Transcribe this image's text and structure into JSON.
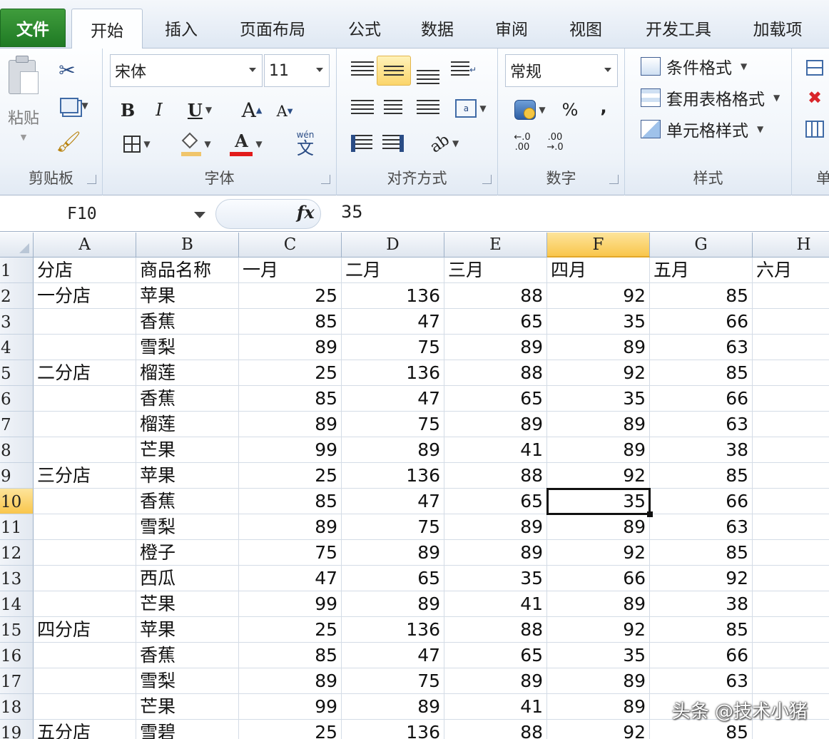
{
  "tabs": {
    "file": "文件",
    "items": [
      "开始",
      "插入",
      "页面布局",
      "公式",
      "数据",
      "审阅",
      "视图",
      "开发工具",
      "加载项"
    ]
  },
  "ribbon": {
    "clipboard": {
      "label": "剪贴板",
      "paste": "粘贴"
    },
    "font": {
      "label": "字体",
      "name": "宋体",
      "size": "11",
      "bold": "B",
      "italic": "I",
      "underline": "U",
      "grow": "A",
      "shrink": "A",
      "wen": "wén",
      "wen_char": "文"
    },
    "alignment": {
      "label": "对齐方式"
    },
    "number": {
      "label": "数字",
      "format": "常规",
      "percent": "%",
      "comma": ",",
      "inc": "←.0 .00",
      "dec": ".00 →.0"
    },
    "styles": {
      "label": "样式",
      "conditional": "条件格式",
      "table": "套用表格格式",
      "cell_styles": "单元格样式"
    },
    "cells": {
      "label": "单"
    }
  },
  "formula_bar": {
    "name_box": "F10",
    "fx": "fx",
    "value": "35"
  },
  "grid": {
    "columns": [
      "A",
      "B",
      "C",
      "D",
      "E",
      "F",
      "G",
      "H"
    ],
    "selected_column": "F",
    "selected_row": "10",
    "rows": [
      {
        "n": "1",
        "a": "分店",
        "b": "商品名称",
        "c": "一月",
        "d": "二月",
        "e": "三月",
        "f": "四月",
        "g": "五月",
        "h": "六月"
      },
      {
        "n": "2",
        "a": "一分店",
        "b": "苹果",
        "c": "25",
        "d": "136",
        "e": "88",
        "f": "92",
        "g": "85",
        "h": ""
      },
      {
        "n": "3",
        "a": "",
        "b": "香蕉",
        "c": "85",
        "d": "47",
        "e": "65",
        "f": "35",
        "g": "66",
        "h": ""
      },
      {
        "n": "4",
        "a": "",
        "b": "雪梨",
        "c": "89",
        "d": "75",
        "e": "89",
        "f": "89",
        "g": "63",
        "h": ""
      },
      {
        "n": "5",
        "a": "二分店",
        "b": "榴莲",
        "c": "25",
        "d": "136",
        "e": "88",
        "f": "92",
        "g": "85",
        "h": ""
      },
      {
        "n": "6",
        "a": "",
        "b": "香蕉",
        "c": "85",
        "d": "47",
        "e": "65",
        "f": "35",
        "g": "66",
        "h": ""
      },
      {
        "n": "7",
        "a": "",
        "b": "榴莲",
        "c": "89",
        "d": "75",
        "e": "89",
        "f": "89",
        "g": "63",
        "h": ""
      },
      {
        "n": "8",
        "a": "",
        "b": "芒果",
        "c": "99",
        "d": "89",
        "e": "41",
        "f": "89",
        "g": "38",
        "h": ""
      },
      {
        "n": "9",
        "a": "三分店",
        "b": "苹果",
        "c": "25",
        "d": "136",
        "e": "88",
        "f": "92",
        "g": "85",
        "h": ""
      },
      {
        "n": "10",
        "a": "",
        "b": "香蕉",
        "c": "85",
        "d": "47",
        "e": "65",
        "f": "35",
        "g": "66",
        "h": ""
      },
      {
        "n": "11",
        "a": "",
        "b": "雪梨",
        "c": "89",
        "d": "75",
        "e": "89",
        "f": "89",
        "g": "63",
        "h": ""
      },
      {
        "n": "12",
        "a": "",
        "b": "橙子",
        "c": "75",
        "d": "89",
        "e": "89",
        "f": "92",
        "g": "85",
        "h": ""
      },
      {
        "n": "13",
        "a": "",
        "b": "西瓜",
        "c": "47",
        "d": "65",
        "e": "35",
        "f": "66",
        "g": "92",
        "h": ""
      },
      {
        "n": "14",
        "a": "",
        "b": "芒果",
        "c": "99",
        "d": "89",
        "e": "41",
        "f": "89",
        "g": "38",
        "h": ""
      },
      {
        "n": "15",
        "a": "四分店",
        "b": "苹果",
        "c": "25",
        "d": "136",
        "e": "88",
        "f": "92",
        "g": "85",
        "h": ""
      },
      {
        "n": "16",
        "a": "",
        "b": "香蕉",
        "c": "85",
        "d": "47",
        "e": "65",
        "f": "35",
        "g": "66",
        "h": ""
      },
      {
        "n": "17",
        "a": "",
        "b": "雪梨",
        "c": "89",
        "d": "75",
        "e": "89",
        "f": "89",
        "g": "63",
        "h": ""
      },
      {
        "n": "18",
        "a": "",
        "b": "芒果",
        "c": "99",
        "d": "89",
        "e": "41",
        "f": "89",
        "g": "",
        "h": ""
      },
      {
        "n": "19",
        "a": "五分店",
        "b": "雪碧",
        "c": "25",
        "d": "136",
        "e": "88",
        "f": "92",
        "g": "85",
        "h": ""
      }
    ]
  },
  "watermark": "头条 @技术小猪"
}
